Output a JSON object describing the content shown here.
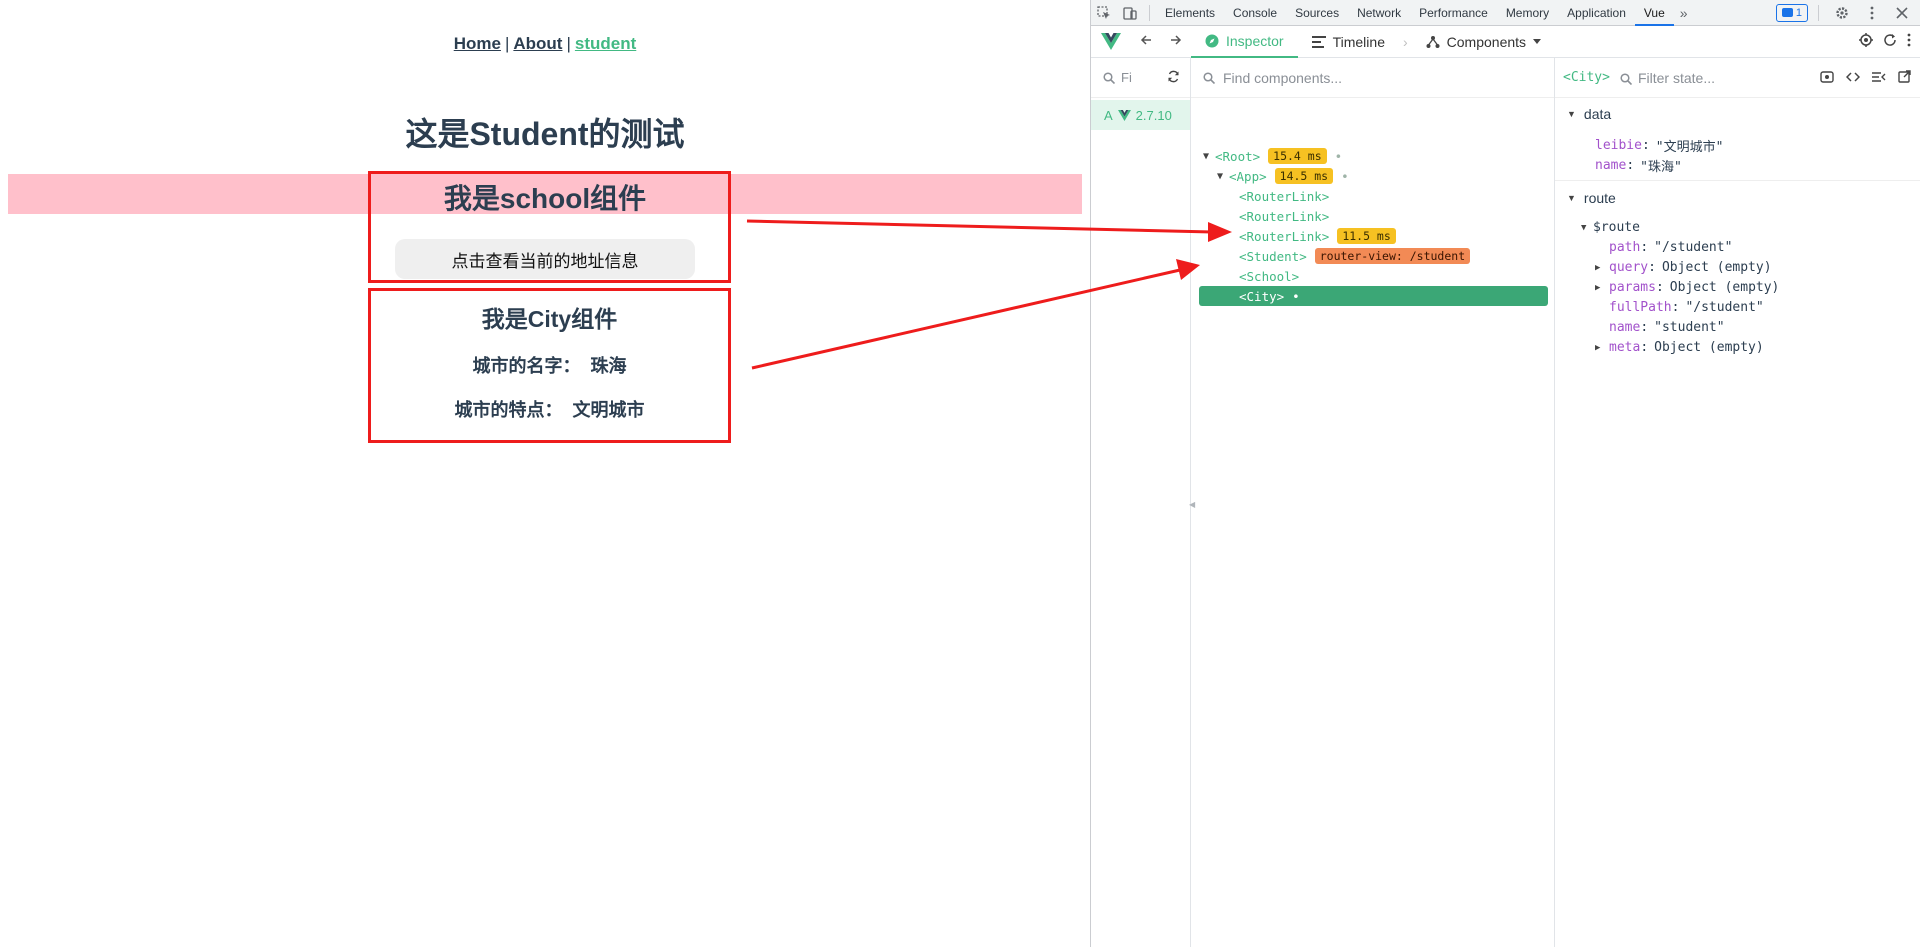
{
  "page": {
    "nav": {
      "home": "Home",
      "about": "About",
      "student": "student",
      "sep": "|"
    },
    "title": "这是Student的测试",
    "school": {
      "title": "我是school组件",
      "button": "点击查看当前的地址信息"
    },
    "city": {
      "title": "我是City组件",
      "name_label": "城市的名字：",
      "name_value": "珠海",
      "feature_label": "城市的特点：",
      "feature_value": "文明城市"
    }
  },
  "devtools": {
    "tabs": [
      "Elements",
      "Console",
      "Sources",
      "Network",
      "Performance",
      "Memory",
      "Application",
      "Vue"
    ],
    "active_tab": "Vue",
    "more": "»",
    "messages_count": "1",
    "vue_toolbar": {
      "inspector": "Inspector",
      "timeline": "Timeline",
      "components": "Components"
    },
    "apps": {
      "filter": "Fi",
      "app_letter": "A",
      "version": "2.7.10"
    },
    "tree": {
      "search_placeholder": "Find components...",
      "rows": [
        {
          "name": "<Root>",
          "badge": "15.4 ms"
        },
        {
          "name": "<App>",
          "badge": "14.5 ms"
        },
        {
          "name": "<RouterLink>"
        },
        {
          "name": "<RouterLink>"
        },
        {
          "name": "<RouterLink>",
          "badge": "11.5 ms"
        },
        {
          "name": "<Student>",
          "route": "router-view: /student"
        },
        {
          "name": "<School>"
        },
        {
          "name": "<City>"
        }
      ]
    },
    "state": {
      "component": "<City>",
      "filter_placeholder": "Filter state...",
      "data_label": "data",
      "data": [
        {
          "key": "leibie",
          "value": "\"文明城市\""
        },
        {
          "key": "name",
          "value": "\"珠海\""
        }
      ],
      "route_label": "route",
      "route_obj": "$route",
      "route": [
        {
          "key": "path",
          "value": "\"/student\""
        },
        {
          "key": "query",
          "value": "Object (empty)"
        },
        {
          "key": "params",
          "value": "Object (empty)"
        },
        {
          "key": "fullPath",
          "value": "\"/student\""
        },
        {
          "key": "name",
          "value": "\"student\""
        },
        {
          "key": "meta",
          "value": "Object (empty)"
        }
      ]
    }
  },
  "colors": {
    "vue_green": "#42b983",
    "annotation_red": "#ee1c1c",
    "school_band": "#ffc0cb",
    "badge_yellow": "#f6c122",
    "badge_orange": "#f28a55"
  }
}
